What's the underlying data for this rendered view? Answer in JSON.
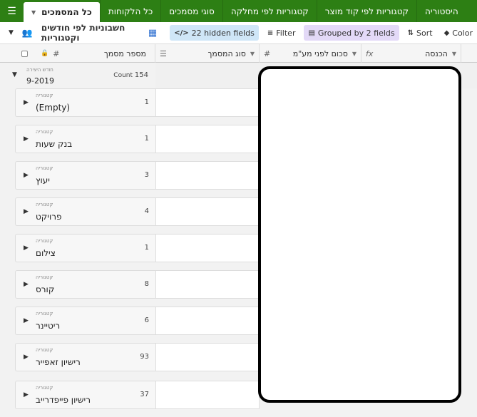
{
  "tabs": [
    {
      "label": "כל המסמכים",
      "active": true
    },
    {
      "label": "כל הלקוחות"
    },
    {
      "label": "סוגי מסמכים"
    },
    {
      "label": "קטגוריות לפי מחלקה"
    },
    {
      "label": "קטגוריות לפי קוד מוצר"
    },
    {
      "label": "היסטוריה"
    }
  ],
  "toolbar": {
    "view_name": "חשבוניות לפי חודשים וקטגוריות",
    "hidden_fields": "22 hidden fields",
    "filter": "Filter",
    "grouped": "Grouped by 2 fields",
    "sort": "Sort",
    "color": "Color"
  },
  "columns": {
    "doc_number": "מספר מסמך",
    "doc_type": "סוג המסמך",
    "amount_before_vat": "סכום לפני מע\"מ",
    "income": "הכנסה"
  },
  "group_top": {
    "label": "חודש היצירה",
    "value": "9-2019",
    "count_label": "Count",
    "count": "154"
  },
  "groups": [
    {
      "label": "קטגוריה",
      "value": "(Empty)",
      "count": "1"
    },
    {
      "label": "קטגוריה",
      "value": "בנק שעות",
      "count": "1"
    },
    {
      "label": "קטגוריה",
      "value": "יעוץ",
      "count": "3"
    },
    {
      "label": "קטגוריה",
      "value": "פרויקט",
      "count": "4"
    },
    {
      "label": "קטגוריה",
      "value": "צילום",
      "count": "1"
    },
    {
      "label": "קטגוריה",
      "value": "קורס",
      "count": "8"
    },
    {
      "label": "קטגוריה",
      "value": "ריטיינר",
      "count": "6"
    },
    {
      "label": "קטגוריה",
      "value": "רישיון זאפייר",
      "count": "93"
    },
    {
      "label": "קטגוריה",
      "value": "רישיון פייפדרייב",
      "count": "37"
    }
  ],
  "colors": {
    "tabbar": "#2d7f14",
    "hidden_fields_bg": "#cfe6f7",
    "grouped_bg": "#e3d9f7"
  }
}
